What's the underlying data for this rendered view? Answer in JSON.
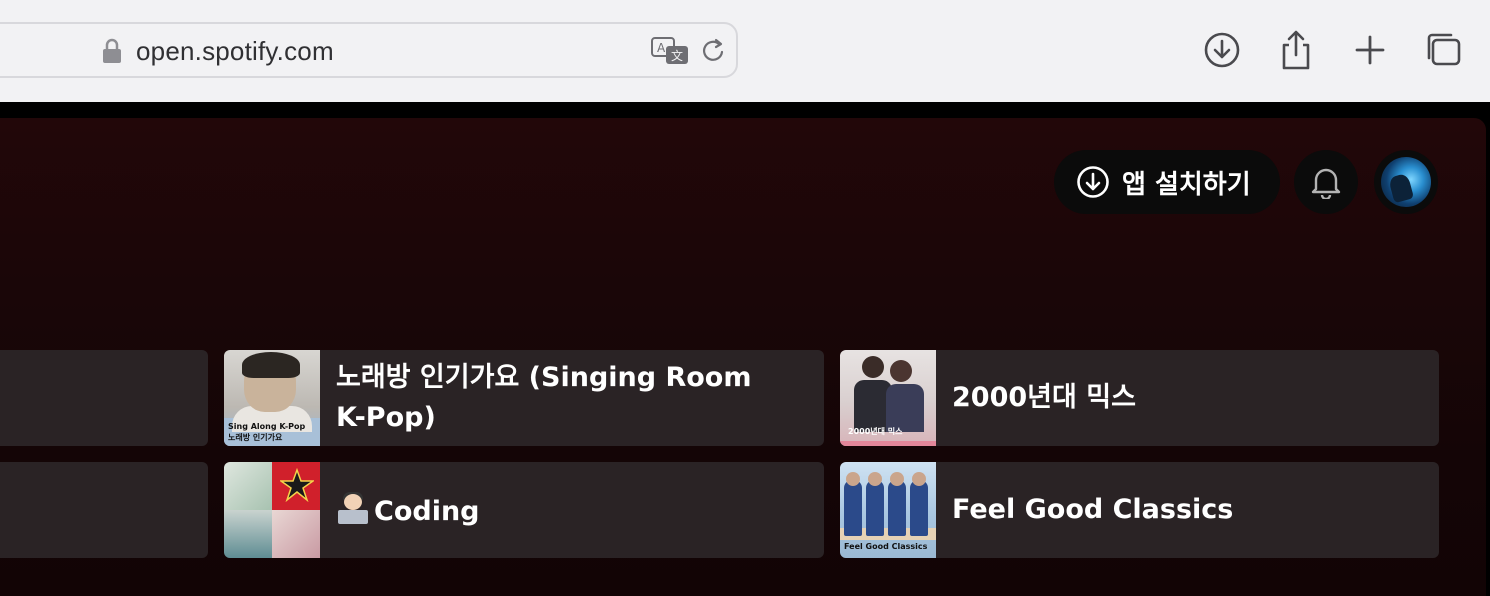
{
  "browser": {
    "url": "open.spotify.com"
  },
  "header": {
    "install_label": "앱 설치하기"
  },
  "cards": [
    {
      "title_line1": "노래방 인기가요 (Singing Room",
      "title_line2": "K-Pop)",
      "art_caption1": "Sing Along K-Pop",
      "art_caption2": "노래방 인기가요"
    },
    {
      "title": "2000년대 믹스",
      "art_caption": "2000년대 믹스"
    },
    {
      "title": "Coding"
    },
    {
      "title": "Feel Good Classics",
      "art_caption": "Feel Good Classics"
    }
  ],
  "colors": {
    "panel_top": "#220709",
    "card_bg": "#2a2325",
    "button_bg": "#0b0b0b"
  }
}
